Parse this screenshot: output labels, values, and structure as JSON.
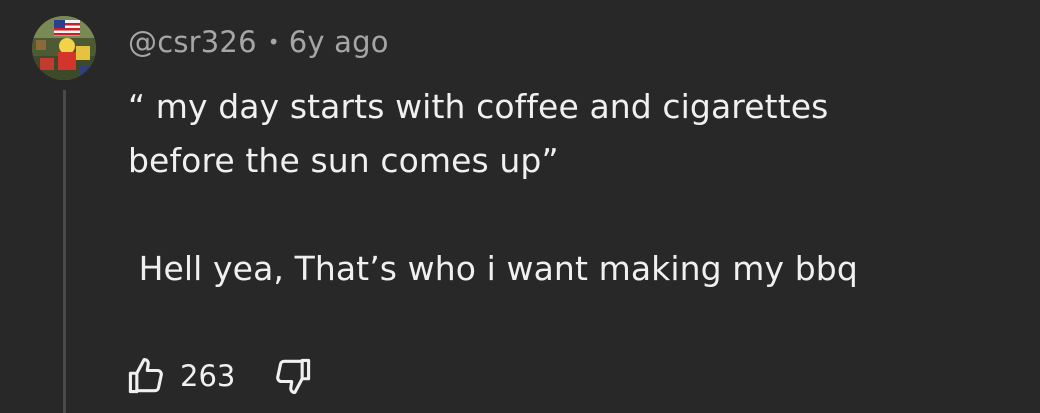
{
  "comment": {
    "author": "@csr326",
    "separator": "•",
    "age": "6y ago",
    "text_line1": "“ my day starts with coffee and cigarettes",
    "text_line2": "before the sun comes up”",
    "text_line3": " Hell yea, That’s who i want making my bbq",
    "like_count": "263"
  },
  "icons": {
    "like": "thumbs-up-outline",
    "dislike": "thumbs-down-outline"
  },
  "colors": {
    "background": "#282828",
    "text": "#f0f0f0",
    "meta": "#a6a6a6",
    "thread_line": "#4b4b4b"
  }
}
